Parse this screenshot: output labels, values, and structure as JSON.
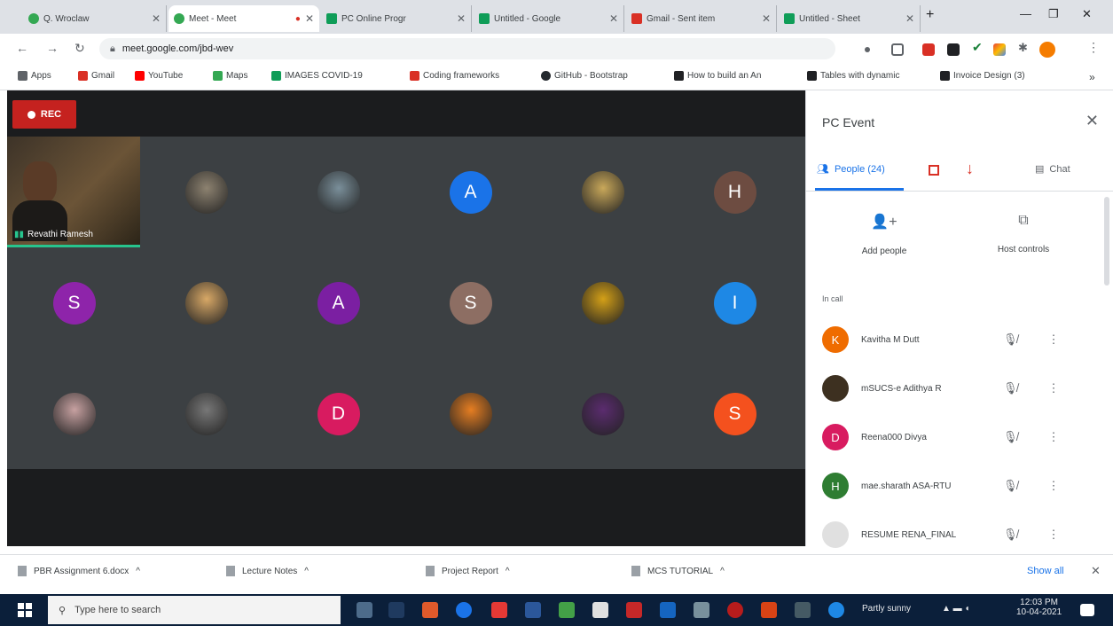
{
  "browser": {
    "tabs": [
      {
        "title": "Q. Wroclaw",
        "active": false,
        "icon": "g"
      },
      {
        "title": "Meet - Meet",
        "active": true,
        "icon": "g"
      },
      {
        "title": "PC Online Progr",
        "active": false,
        "icon": "s"
      },
      {
        "title": "Untitled - Google",
        "active": false,
        "icon": "s"
      },
      {
        "title": "Gmail - Sent item",
        "active": false,
        "icon": "m"
      },
      {
        "title": "Untitled - Sheet",
        "active": false,
        "icon": "s"
      }
    ],
    "new_tab": "+",
    "url": "meet.google.com/jbd-wev",
    "bookmarks": [
      {
        "label": "Apps",
        "color": "#5f6368"
      },
      {
        "label": "Gmail",
        "color": "#d93025"
      },
      {
        "label": "YouTube",
        "color": "#ff0000"
      },
      {
        "label": "Maps",
        "color": "#34a853"
      },
      {
        "label": "IMAGES COVID-19",
        "color": "#0f9d58"
      },
      {
        "label": "Coding frameworks",
        "color": "#d93025"
      },
      {
        "label": "GitHub - Bootstrap",
        "color": "#24292e"
      },
      {
        "label": "How to build an An",
        "color": "#202124"
      },
      {
        "label": "Tables with dynamic",
        "color": "#202124"
      },
      {
        "label": "Invoice Design (3)",
        "color": "#202124"
      }
    ]
  },
  "meet": {
    "rec_label": "REC",
    "self_name": "Revathi Ramesh",
    "tiles": [
      {
        "letter": "",
        "color": "#8d8270",
        "photo": true
      },
      {
        "letter": "",
        "color": "#7a8f9a",
        "photo": true
      },
      {
        "letter": "A",
        "color": "#1a73e8",
        "photo": false
      },
      {
        "letter": "",
        "color": "#c9a85a",
        "photo": true
      },
      {
        "letter": "H",
        "color": "#6d4c41",
        "photo": false
      },
      {
        "letter": "S",
        "color": "#8e24aa",
        "photo": false
      },
      {
        "letter": "",
        "color": "#d8a866",
        "photo": true
      },
      {
        "letter": "A",
        "color": "#7b1fa2",
        "photo": false
      },
      {
        "letter": "S",
        "color": "#8d6e63",
        "photo": false
      },
      {
        "letter": "",
        "color": "#d4a017",
        "photo": true
      },
      {
        "letter": "I",
        "color": "#1e88e5",
        "photo": false
      },
      {
        "letter": "",
        "color": "#c7a1a1",
        "photo": true
      },
      {
        "letter": "",
        "color": "#777",
        "photo": true
      },
      {
        "letter": "D",
        "color": "#d81b60",
        "photo": false
      },
      {
        "letter": "",
        "color": "#e67e22",
        "photo": true
      },
      {
        "letter": "",
        "color": "#5b2c6f",
        "photo": true
      },
      {
        "letter": "S",
        "color": "#f4511e",
        "photo": false
      }
    ]
  },
  "panel": {
    "title": "PC Event",
    "tab_people": "People (24)",
    "tab_chat": "Chat",
    "add_people": "Add people",
    "host_controls": "Host controls",
    "section_label": "In call",
    "participants": [
      {
        "initial": "K",
        "name": "Kavitha M Dutt",
        "color": "#ef6c00"
      },
      {
        "initial": "",
        "name": "mSUCS-e Adithya R",
        "color": "#3d3020"
      },
      {
        "initial": "D",
        "name": "Reena000 Divya",
        "color": "#d81b60"
      },
      {
        "initial": "H",
        "name": "mae.sharath ASA-RTU",
        "color": "#2e7d32"
      },
      {
        "initial": "",
        "name": "RESUME RENA_FINAL",
        "color": "#e0e0e0"
      }
    ]
  },
  "downloads": {
    "items": [
      "PBR Assignment 6.docx",
      "Lecture Notes",
      "Project Report",
      "MCS TUTORIAL"
    ],
    "show_all": "Show all"
  },
  "taskbar": {
    "search_placeholder": "Type here to search",
    "weather": "Partly sunny",
    "time": "12:03 PM",
    "date": "10-04-2021"
  }
}
